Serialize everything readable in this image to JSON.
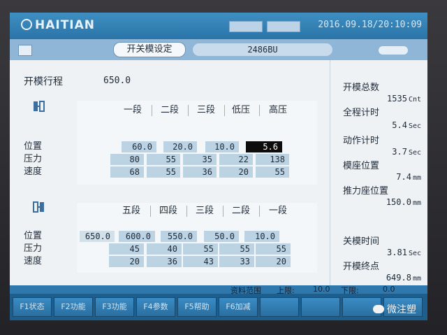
{
  "header": {
    "logo": "HAITIAN",
    "datetime": "2016.09.18/20:10:09"
  },
  "tabbar": {
    "active_tab": "开关模设定",
    "info": "2486BU"
  },
  "mold_open_stroke": {
    "label": "开模行程",
    "value": "650.0"
  },
  "mold_open_table": {
    "columns": [
      "一段",
      "二段",
      "三段",
      "低压",
      "高压"
    ],
    "rows": {
      "position": {
        "label": "位置",
        "values": [
          "60.0",
          "20.0",
          "10.0",
          "5.6"
        ]
      },
      "pressure": {
        "label": "压力",
        "values": [
          "80",
          "55",
          "35",
          "22",
          "138"
        ]
      },
      "speed": {
        "label": "速度",
        "values": [
          "68",
          "55",
          "36",
          "20",
          "55"
        ]
      }
    }
  },
  "mold_close_table": {
    "columns": [
      "五段",
      "四段",
      "三段",
      "二段",
      "一段"
    ],
    "rows": {
      "position": {
        "label": "位置",
        "values": [
          "650.0",
          "600.0",
          "550.0",
          "50.0",
          "10.0"
        ]
      },
      "pressure": {
        "label": "压力",
        "values": [
          "45",
          "40",
          "55",
          "55",
          "55"
        ]
      },
      "speed": {
        "label": "速度",
        "values": [
          "20",
          "36",
          "43",
          "33",
          "20"
        ]
      }
    }
  },
  "status": {
    "open_count": {
      "label": "开模总数",
      "value": "1535",
      "unit": "Cnt"
    },
    "cycle_time": {
      "label": "全程计时",
      "value": "5.4",
      "unit": "Sec"
    },
    "action_time": {
      "label": "动作计时",
      "value": "3.7",
      "unit": "Sec"
    },
    "platen_pos": {
      "label": "模座位置",
      "value": "7.4",
      "unit": "mm"
    },
    "thrust_pos": {
      "label": "推力座位置",
      "value": "150.0",
      "unit": "mm"
    },
    "close_time": {
      "label": "关模时间",
      "value": "3.81",
      "unit": "Sec"
    },
    "open_end": {
      "label": "开模终点",
      "value": "649.8",
      "unit": "mm"
    }
  },
  "limits": {
    "range_label": "资料范围",
    "upper_label": "上限:",
    "upper_value": "10.0",
    "lower_label": "下限:",
    "lower_value": "0.0"
  },
  "fkeys": [
    "F1状态",
    "F2功能",
    "F3功能",
    "F4参数",
    "F5帮助",
    "F6加减",
    "",
    "",
    "",
    ""
  ],
  "watermark": "微注塑"
}
